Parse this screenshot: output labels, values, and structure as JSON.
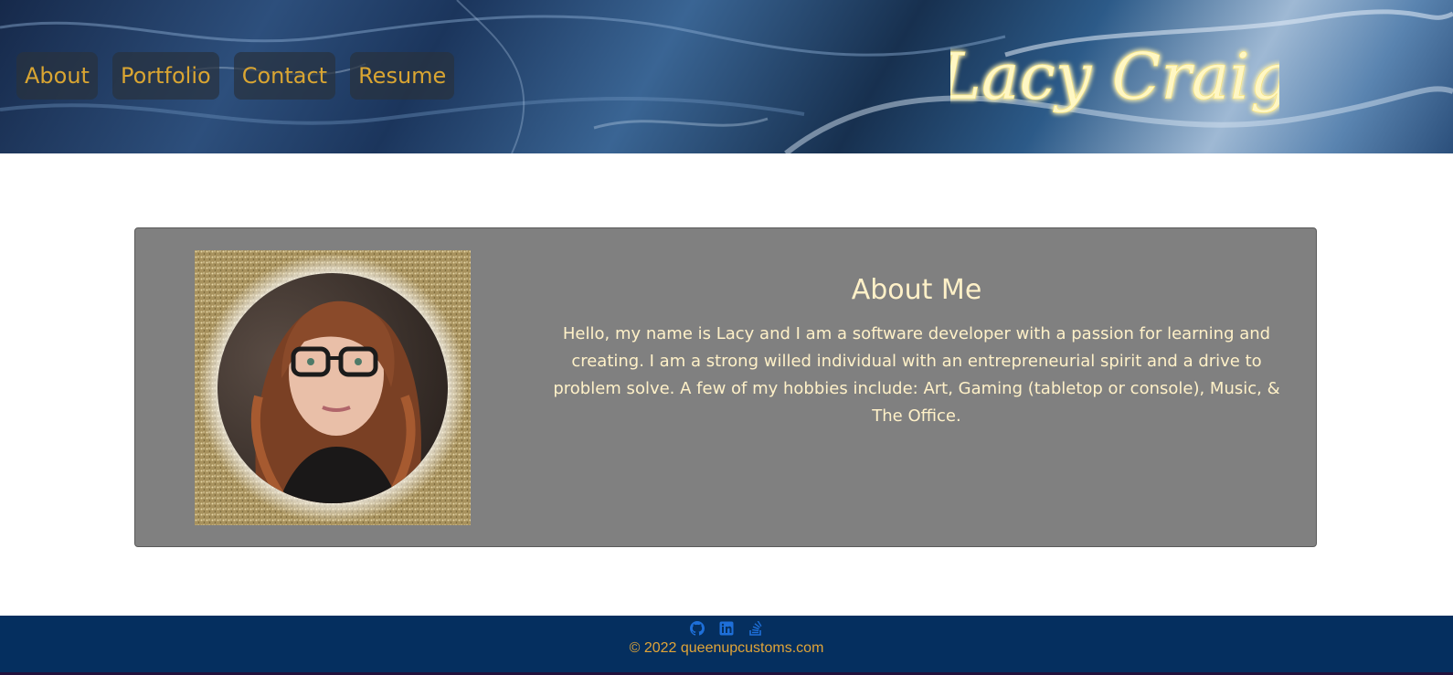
{
  "header": {
    "brand_name": "Lacy Craig",
    "nav": [
      {
        "label": "About"
      },
      {
        "label": "Portfolio"
      },
      {
        "label": "Contact"
      },
      {
        "label": "Resume"
      }
    ]
  },
  "about": {
    "title": "About Me",
    "body": "Hello, my name is Lacy and I am a software developer with a passion for learning and creating. I am a strong willed individual with an entrepreneurial spirit and a drive to problem solve. A few of my hobbies include: Art, Gaming (tabletop or console), Music, & The Office."
  },
  "footer": {
    "social_icons": [
      "github-icon",
      "linkedin-icon",
      "stack-overflow-icon"
    ],
    "copyright": "© 2022 queenupcustoms.com"
  },
  "colors": {
    "nav_text": "#d9a532",
    "card_bg": "#808080",
    "about_text": "#fff1c8",
    "footer_bg": "#052f5f",
    "footer_text": "#e0a438",
    "icon_color": "#1e6fd9",
    "brand_glow": "#fff2a0"
  }
}
